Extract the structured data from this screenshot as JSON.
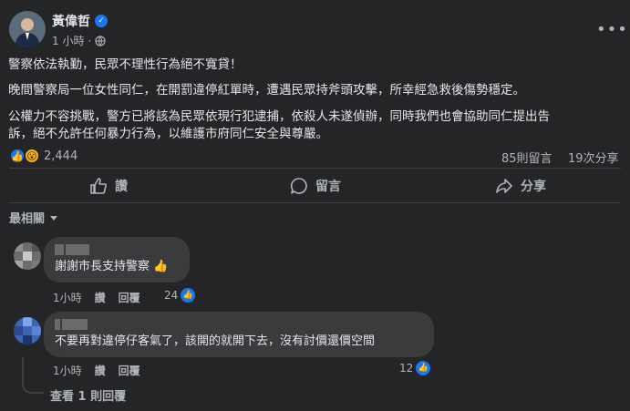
{
  "post": {
    "author": "黃偉哲",
    "time": "1 小時",
    "lines": [
      "警察依法執勤，民眾不理性行為絕不寬貸！",
      "晚間警察局一位女性同仁，在開罰違停紅單時，遭遇民眾持斧頭攻擊，所幸經急救後傷勢穩定。",
      "公權力不容挑戰，警方已將該為民眾依現行犯逮捕，依殺人未遂偵辦，同時我們也會協助同仁提出告",
      "訴，絕不允許任何暴力行為，以維護市府同仁安全與尊嚴。"
    ],
    "reaction_count": "2,444",
    "comments_count": "85則留言",
    "shares_count": "19次分享"
  },
  "actions": {
    "like": "讚",
    "comment": "留言",
    "share": "分享"
  },
  "sort_label": "最相關",
  "comments": [
    {
      "text": "謝謝市長支持警察",
      "emoji": "👍",
      "time": "1小時",
      "like": "讚",
      "reply": "回覆",
      "likes": "24"
    },
    {
      "text": "不要再對違停仔客氣了，該開的就開下去，沒有討價還價空間",
      "time": "1小時",
      "like": "讚",
      "reply": "回覆",
      "likes": "12"
    }
  ],
  "view_replies": "查看 1 則回覆",
  "colors": {
    "background": "#242526",
    "bubble": "#3a3b3c",
    "accent": "#1877f2",
    "secondary_text": "#b0b3b8"
  }
}
